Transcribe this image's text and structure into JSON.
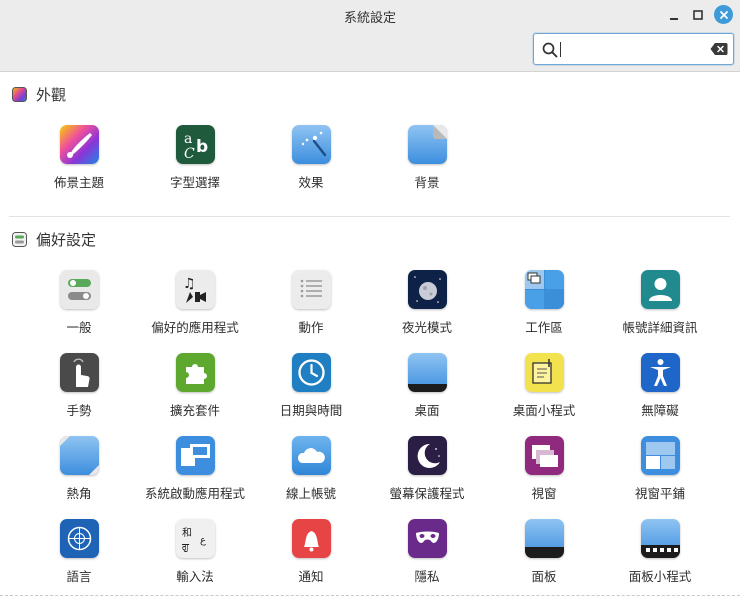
{
  "window": {
    "title": "系統設定"
  },
  "search": {
    "value": "",
    "placeholder": ""
  },
  "sections": {
    "appearance": {
      "title": "外觀",
      "items": [
        "佈景主題",
        "字型選擇",
        "效果",
        "背景"
      ]
    },
    "preferences": {
      "title": "偏好設定",
      "items": [
        "一般",
        "偏好的應用程式",
        "動作",
        "夜光模式",
        "工作區",
        "帳號詳細資訊",
        "手勢",
        "擴充套件",
        "日期與時間",
        "桌面",
        "桌面小程式",
        "無障礙",
        "熱角",
        "系統啟動應用程式",
        "線上帳號",
        "螢幕保護程式",
        "視窗",
        "視窗平鋪",
        "語言",
        "輸入法",
        "通知",
        "隱私",
        "面板",
        "面板小程式"
      ]
    }
  },
  "icons": {
    "appearance": [
      "themes-icon",
      "fonts-icon",
      "effects-icon",
      "backgrounds-icon"
    ],
    "preferences": [
      "general-icon",
      "preferred-apps-icon",
      "actions-icon",
      "night-light-icon",
      "workspaces-icon",
      "account-icon",
      "gestures-icon",
      "extensions-icon",
      "clock-icon",
      "desktop-icon",
      "desklets-icon",
      "accessibility-icon",
      "hot-corners-icon",
      "startup-apps-icon",
      "online-accounts-icon",
      "screensaver-icon",
      "windows-icon",
      "window-tiling-icon",
      "languages-icon",
      "input-method-icon",
      "notifications-icon",
      "privacy-icon",
      "panel-icon",
      "applets-icon"
    ]
  },
  "colors": {
    "accent": "#3e9ad8",
    "titlebar": "#ececec"
  }
}
